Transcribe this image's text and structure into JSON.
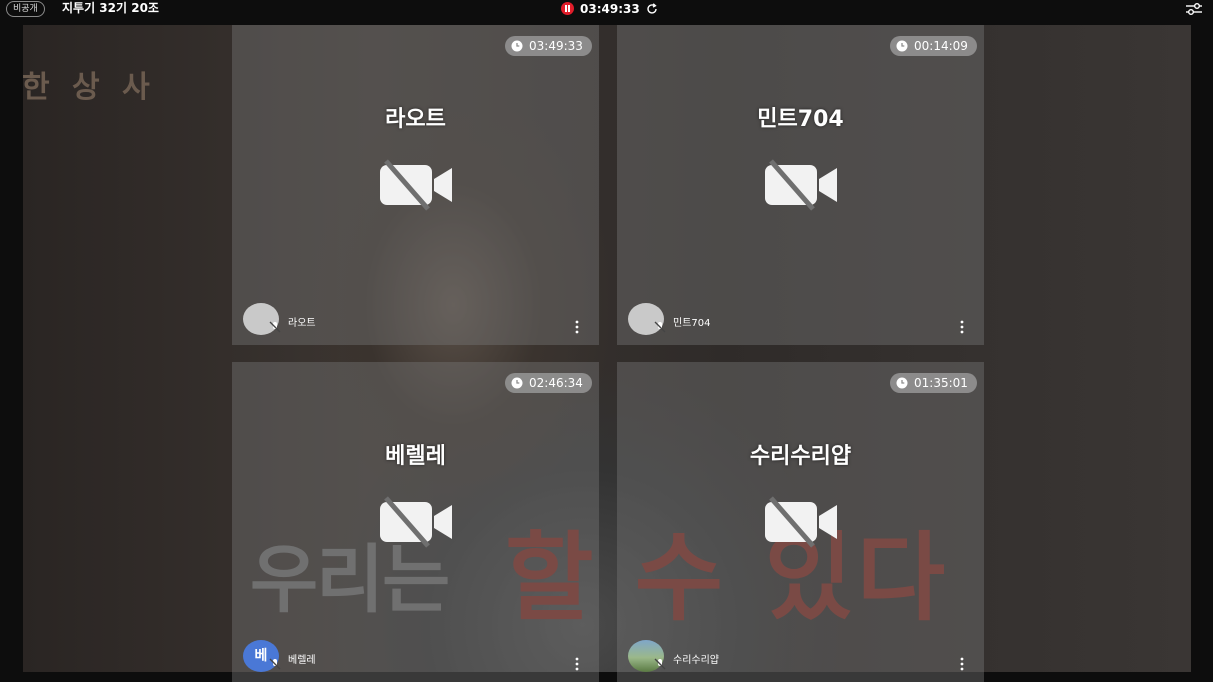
{
  "topbar": {
    "privacy": "비공개",
    "room_title": "지투기 32기 20조",
    "recording_time": "03:49:33"
  },
  "background_captions": {
    "top_left": "한 상 사",
    "bottom_gray": "우리는",
    "bottom_red": "할 수 있다"
  },
  "participants": [
    {
      "name": "라오트",
      "duration": "03:49:33",
      "user_label": "라오트",
      "avatar": "default"
    },
    {
      "name": "민트704",
      "duration": "00:14:09",
      "user_label": "민트704",
      "avatar": "default"
    },
    {
      "name": "베렐레",
      "duration": "02:46:34",
      "user_label": "베렐레",
      "avatar": "letter",
      "avatar_letter": "베"
    },
    {
      "name": "수리수리얍",
      "duration": "01:35:01",
      "user_label": "수리수리얍",
      "avatar": "photo"
    }
  ],
  "colors": {
    "recording": "#e11d2a",
    "avatar_letter_bg": "#4a78d6",
    "tile_overlay": "rgba(120,120,120,0.42)"
  },
  "icons": {
    "recording": "pause-recording-icon",
    "refresh": "refresh-icon",
    "settings": "settings-sliders-icon",
    "timer": "clock-icon",
    "camera": "camera-off-icon",
    "mic": "mic-off-icon",
    "menu": "more-vertical-icon"
  }
}
